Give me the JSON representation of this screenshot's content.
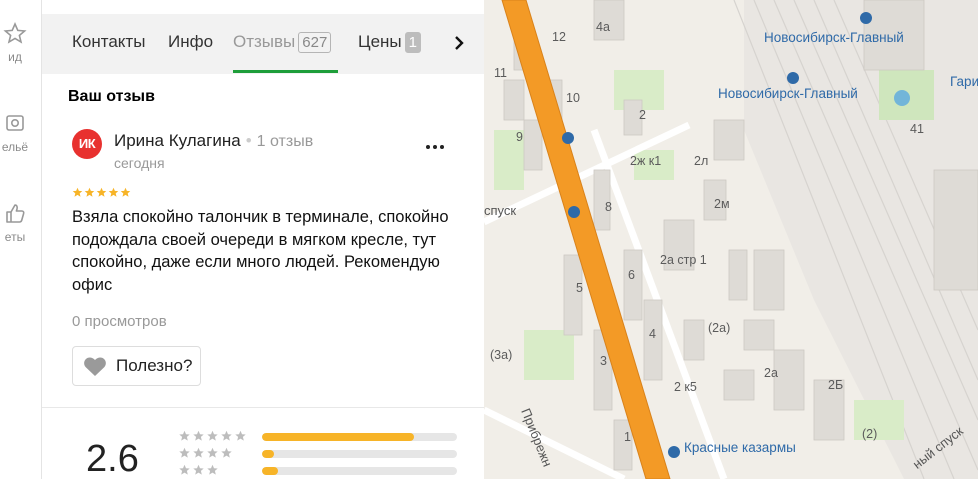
{
  "rail": {
    "items": [
      {
        "label": "ид",
        "icon": "star-icon"
      },
      {
        "label": "ельё",
        "icon": "photo-icon"
      },
      {
        "label": "еты",
        "icon": "thumb-up-icon"
      }
    ]
  },
  "tabs": [
    {
      "label": "Контакты",
      "count": ""
    },
    {
      "label": "Инфо",
      "count": ""
    },
    {
      "label": "Отзывы",
      "count": "627",
      "active": true
    },
    {
      "label": "Цены",
      "count": "1"
    }
  ],
  "review": {
    "heading": "Ваш отзыв",
    "avatar_initials": "ИК",
    "avatar_color": "#e8312f",
    "author": "Ирина Кулагина",
    "author_reviews": "1 отзыв",
    "date": "сегодня",
    "stars": 5,
    "text": "Взяла спокойно талончик в терминале, спокойно подождала своей очереди в мягком кресле, тут спокойно, даже если много людей. Рекомендую офис",
    "views": "0 просмотров",
    "helpful_label": "Полезно?"
  },
  "rating": {
    "value": "2.6",
    "distribution": [
      {
        "stars": 5,
        "fraction": 0.78
      },
      {
        "stars": 4,
        "fraction": 0.06
      },
      {
        "stars": 3,
        "fraction": 0.08
      }
    ]
  },
  "colors": {
    "accent_green": "#1e9e3a",
    "star_gold": "#f7b428",
    "road_orange": "#f39a26",
    "station_blue": "#2f6aa8"
  },
  "map": {
    "labels": {
      "station1": "Новосибирск-Главный",
      "station2": "Новосибирск-Главный",
      "gari": "Гари",
      "krasnye": "Красные казармы",
      "spusk_left": "спуск",
      "spusk_right": "ный спуск",
      "pribrezh": "Прибрежн",
      "n12": "12",
      "n4a": "4а",
      "n11": "11",
      "n10": "10",
      "n9": "9",
      "n2": "2",
      "n2zhk1": "2ж к1",
      "n2l": "2л",
      "n2m": "2м",
      "n8": "8",
      "n2astr1": "2а стр 1",
      "n6": "6",
      "n5": "5",
      "n4": "4",
      "n2a_p": "(2а)",
      "n3a_p": "(3а)",
      "n3": "3",
      "n2k5": "2 к5",
      "n2a": "2а",
      "n2b": "2Б",
      "n2_p": "(2)",
      "n1": "1",
      "n41": "41"
    }
  }
}
